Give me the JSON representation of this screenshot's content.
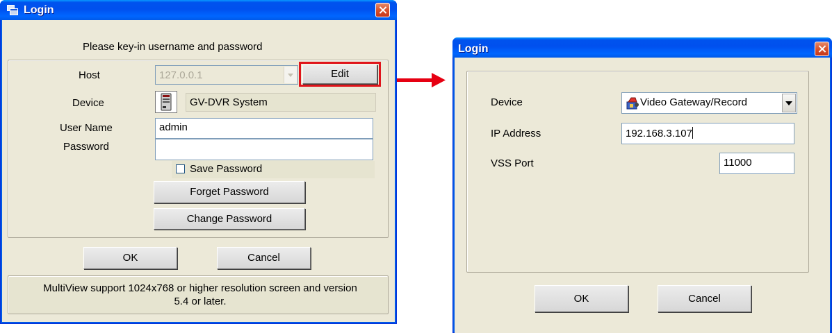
{
  "left_dialog": {
    "title": "Login",
    "instruction": "Please key-in username and password",
    "host_label": "Host",
    "host_value": "127.0.0.1",
    "edit_button": "Edit",
    "device_label": "Device",
    "device_value": "GV-DVR System",
    "username_label": "User Name",
    "username_value": "admin",
    "password_label": "Password",
    "password_value": "",
    "save_password_label": "Save Password",
    "save_password_checked": false,
    "forget_password_button": "Forget Password",
    "change_password_button": "Change Password",
    "ok_button": "OK",
    "cancel_button": "Cancel",
    "note": "MultiView support 1024x768 or higher resolution screen and version 5.4 or later."
  },
  "right_dialog": {
    "title": "Login",
    "device_label": "Device",
    "device_value": "Video Gateway/Record",
    "ip_label": "IP Address",
    "ip_value": "192.168.3.107",
    "port_label": "VSS Port",
    "port_value": "11000",
    "ok_button": "OK",
    "cancel_button": "Cancel"
  },
  "colors": {
    "highlight": "#e0141b",
    "arrow": "#e60012",
    "titlebar": "#0058e6"
  },
  "icons": [
    "login-window-icon",
    "dvr-device-icon",
    "gateway-device-icon",
    "close-icon",
    "dropdown-arrow-icon",
    "red-arrow-icon"
  ]
}
